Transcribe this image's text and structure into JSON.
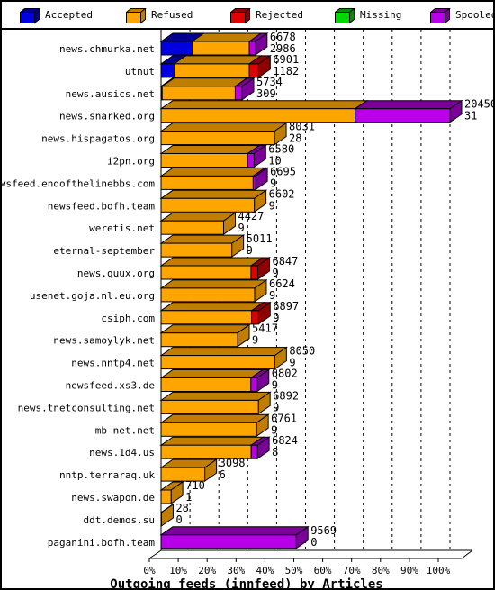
{
  "legend": {
    "items": [
      {
        "label": "Accepted",
        "color": "#0000E0",
        "side": "#000090",
        "icon": "cube-icon"
      },
      {
        "label": "Refused",
        "color": "#FFA500",
        "side": "#C07D00",
        "icon": "cube-icon"
      },
      {
        "label": "Rejected",
        "color": "#E00000",
        "side": "#900000",
        "icon": "cube-icon"
      },
      {
        "label": "Missing",
        "color": "#00D800",
        "side": "#009000",
        "icon": "cube-icon"
      },
      {
        "label": "Spooled",
        "color": "#B800E8",
        "side": "#7A0099",
        "icon": "cube-icon"
      }
    ]
  },
  "chart_data": {
    "type": "bar",
    "orientation": "horizontal",
    "stacked": true,
    "title": "Outgoing feeds (innfeed) by Articles",
    "xlabel": "",
    "ylabel": "",
    "xlim": [
      0,
      100
    ],
    "xtick_labels": [
      "0%",
      "10%",
      "20%",
      "30%",
      "40%",
      "50%",
      "60%",
      "70%",
      "80%",
      "90%",
      "100%"
    ],
    "xticks": [
      0,
      10,
      20,
      30,
      40,
      50,
      60,
      70,
      80,
      90,
      100
    ],
    "grid": true,
    "legend_position": "top",
    "series_names": [
      "Accepted",
      "Refused",
      "Rejected",
      "Missing",
      "Spooled"
    ],
    "series_colors": [
      "#0000E0",
      "#FFA500",
      "#E00000",
      "#00D800",
      "#B800E8"
    ],
    "max_total": 20450,
    "categories": [
      "news.chmurka.net",
      "utnut",
      "news.ausics.net",
      "news.snarked.org",
      "news.hispagatos.org",
      "i2pn.org",
      "newsfeed.endofthelinebbs.com",
      "newsfeed.bofh.team",
      "weretis.net",
      "eternal-september",
      "news.quux.org",
      "usenet.goja.nl.eu.org",
      "csiph.com",
      "news.samoylyk.net",
      "news.nntp4.net",
      "newsfeed.xs3.de",
      "news.tnetconsulting.net",
      "mb-net.net",
      "news.1d4.us",
      "nntp.terraraq.uk",
      "news.swapon.de",
      "ddt.demos.su",
      "paganini.bofh.team"
    ],
    "rows": [
      {
        "category": "news.chmurka.net",
        "total": 6678,
        "value2": 2986,
        "label_top": "6678",
        "label_bottom": "2986",
        "segments": [
          {
            "series": "Accepted",
            "frac": 0.33
          },
          {
            "series": "Refused",
            "frac": 0.605
          },
          {
            "series": "Spooled",
            "frac": 0.065
          }
        ]
      },
      {
        "category": "utnut",
        "total": 6901,
        "value2": 1182,
        "label_top": "6901",
        "label_bottom": "1182",
        "segments": [
          {
            "series": "Accepted",
            "frac": 0.135
          },
          {
            "series": "Refused",
            "frac": 0.77
          },
          {
            "series": "Rejected",
            "frac": 0.095
          }
        ]
      },
      {
        "category": "news.ausics.net",
        "total": 5734,
        "value2": 309,
        "label_top": "5734",
        "label_bottom": "309",
        "segments": [
          {
            "series": "Accepted",
            "frac": 0.014
          },
          {
            "series": "Refused",
            "frac": 0.902
          },
          {
            "series": "Spooled",
            "frac": 0.084
          }
        ]
      },
      {
        "category": "news.snarked.org",
        "total": 20450,
        "value2": 31,
        "label_top": "20450",
        "label_bottom": "31",
        "segments": [
          {
            "series": "Refused",
            "frac": 0.672
          },
          {
            "series": "Spooled",
            "frac": 0.328
          }
        ]
      },
      {
        "category": "news.hispagatos.org",
        "total": 8031,
        "value2": 28,
        "label_top": "8031",
        "label_bottom": "28",
        "segments": [
          {
            "series": "Refused",
            "frac": 1.0
          }
        ]
      },
      {
        "category": "i2pn.org",
        "total": 6580,
        "value2": 10,
        "label_top": "6580",
        "label_bottom": "10",
        "segments": [
          {
            "series": "Refused",
            "frac": 0.93
          },
          {
            "series": "Spooled",
            "frac": 0.07
          }
        ]
      },
      {
        "category": "newsfeed.endofthelinebbs.com",
        "total": 6695,
        "value2": 9,
        "label_top": "6695",
        "label_bottom": "9",
        "segments": [
          {
            "series": "Refused",
            "frac": 0.974
          },
          {
            "series": "Spooled",
            "frac": 0.026
          }
        ]
      },
      {
        "category": "newsfeed.bofh.team",
        "total": 6602,
        "value2": 9,
        "label_top": "6602",
        "label_bottom": "9",
        "segments": [
          {
            "series": "Refused",
            "frac": 1.0
          }
        ]
      },
      {
        "category": "weretis.net",
        "total": 4427,
        "value2": 9,
        "label_top": "4427",
        "label_bottom": "9",
        "segments": [
          {
            "series": "Refused",
            "frac": 1.0
          }
        ]
      },
      {
        "category": "eternal-september",
        "total": 5011,
        "value2": 9,
        "label_top": "5011",
        "label_bottom": "9",
        "segments": [
          {
            "series": "Refused",
            "frac": 1.0
          }
        ]
      },
      {
        "category": "news.quux.org",
        "total": 6847,
        "value2": 9,
        "label_top": "6847",
        "label_bottom": "9",
        "segments": [
          {
            "series": "Refused",
            "frac": 0.93
          },
          {
            "series": "Rejected",
            "frac": 0.07
          }
        ]
      },
      {
        "category": "usenet.goja.nl.eu.org",
        "total": 6624,
        "value2": 9,
        "label_top": "6624",
        "label_bottom": "9",
        "segments": [
          {
            "series": "Refused",
            "frac": 1.0
          }
        ]
      },
      {
        "category": "csiph.com",
        "total": 6897,
        "value2": 9,
        "label_top": "6897",
        "label_bottom": "9",
        "segments": [
          {
            "series": "Refused",
            "frac": 0.93
          },
          {
            "series": "Rejected",
            "frac": 0.07
          }
        ]
      },
      {
        "category": "news.samoylyk.net",
        "total": 5417,
        "value2": 9,
        "label_top": "5417",
        "label_bottom": "9",
        "segments": [
          {
            "series": "Refused",
            "frac": 1.0
          }
        ]
      },
      {
        "category": "news.nntp4.net",
        "total": 8050,
        "value2": 9,
        "label_top": "8050",
        "label_bottom": "9",
        "segments": [
          {
            "series": "Refused",
            "frac": 1.0
          }
        ]
      },
      {
        "category": "newsfeed.xs3.de",
        "total": 6802,
        "value2": 9,
        "label_top": "6802",
        "label_bottom": "9",
        "segments": [
          {
            "series": "Refused",
            "frac": 0.935
          },
          {
            "series": "Spooled",
            "frac": 0.065
          }
        ]
      },
      {
        "category": "news.tnetconsulting.net",
        "total": 6892,
        "value2": 9,
        "label_top": "6892",
        "label_bottom": "9",
        "segments": [
          {
            "series": "Refused",
            "frac": 1.0
          }
        ]
      },
      {
        "category": "mb-net.net",
        "total": 6761,
        "value2": 9,
        "label_top": "6761",
        "label_bottom": "9",
        "segments": [
          {
            "series": "Refused",
            "frac": 1.0
          }
        ]
      },
      {
        "category": "news.1d4.us",
        "total": 6824,
        "value2": 8,
        "label_top": "6824",
        "label_bottom": "8",
        "segments": [
          {
            "series": "Refused",
            "frac": 0.935
          },
          {
            "series": "Spooled",
            "frac": 0.065
          }
        ]
      },
      {
        "category": "nntp.terraraq.uk",
        "total": 3098,
        "value2": 6,
        "label_top": "3098",
        "label_bottom": "6",
        "segments": [
          {
            "series": "Refused",
            "frac": 1.0
          }
        ]
      },
      {
        "category": "news.swapon.de",
        "total": 710,
        "value2": 1,
        "label_top": "710",
        "label_bottom": "1",
        "segments": [
          {
            "series": "Refused",
            "frac": 1.0
          }
        ]
      },
      {
        "category": "ddt.demos.su",
        "total": 28,
        "value2": 0,
        "label_top": "28",
        "label_bottom": "0",
        "segments": [
          {
            "series": "Refused",
            "frac": 1.0
          }
        ]
      },
      {
        "category": "paganini.bofh.team",
        "total": 9569,
        "value2": 0,
        "label_top": "9569",
        "label_bottom": "0",
        "segments": [
          {
            "series": "Spooled",
            "frac": 1.0
          }
        ]
      }
    ]
  }
}
